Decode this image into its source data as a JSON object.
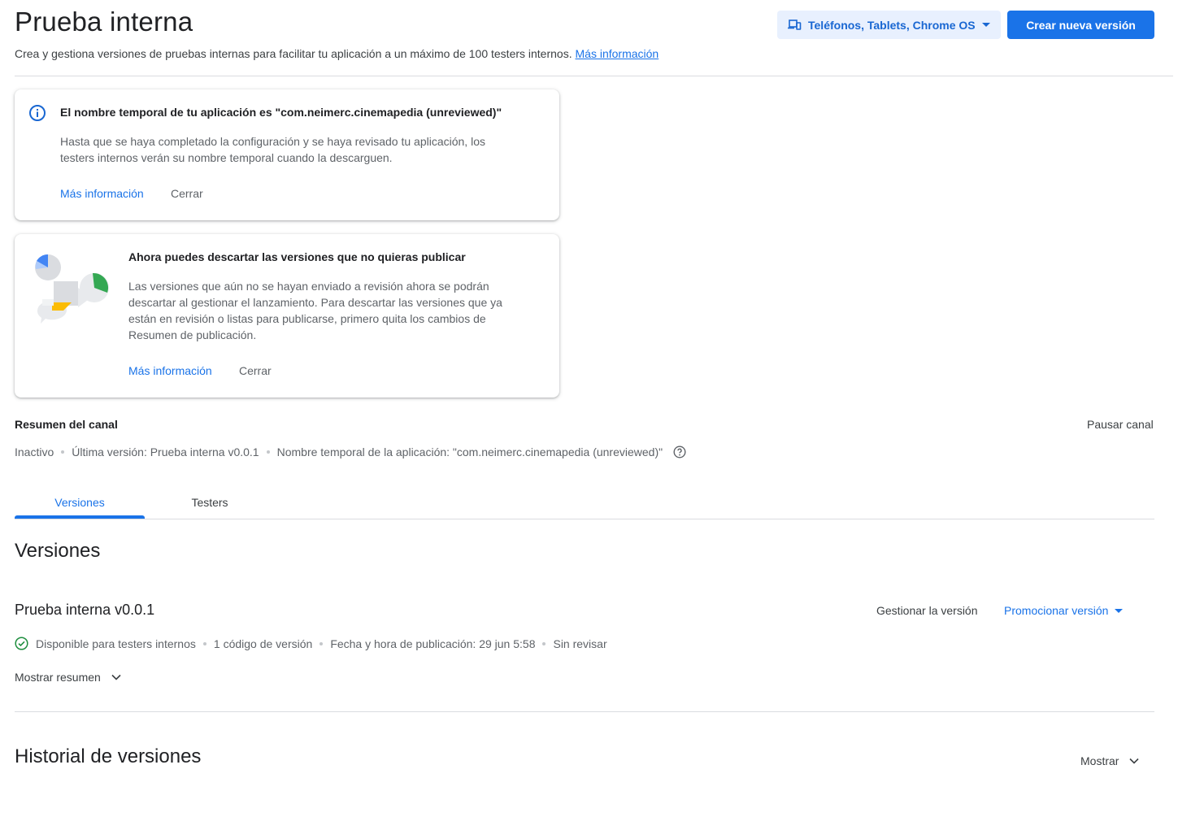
{
  "header": {
    "title": "Prueba interna",
    "subtitle": "Crea y gestiona versiones de pruebas internas para facilitar tu aplicación a un máximo de 100 testers internos.",
    "subtitle_link": "Más información",
    "device_selector": "Teléfonos, Tablets, Chrome OS",
    "create_button": "Crear nueva versión"
  },
  "notice_name": {
    "icon": "info-icon",
    "title": "El nombre temporal de tu aplicación es \"com.neimerc.cinemapedia (unreviewed)\"",
    "body": "Hasta que se haya completado la configuración y se haya revisado tu aplicación, los testers internos verán su nombre temporal cuando la descarguen.",
    "more_link": "Más información",
    "close": "Cerrar"
  },
  "notice_discard": {
    "title": "Ahora puedes descartar las versiones que no quieras publicar",
    "body": "Las versiones que aún no se hayan enviado a revisión ahora se podrán descartar al gestionar el lanzamiento. Para descartar las versiones que ya están en revisión o listas para publicarse, primero quita los cambios de Resumen de publicación.",
    "more_link": "Más información",
    "close": "Cerrar"
  },
  "channel_summary": {
    "label": "Resumen del canal",
    "pause": "Pausar canal",
    "status": "Inactivo",
    "last_version": "Última versión: Prueba interna v0.0.1",
    "temp_name": "Nombre temporal de la aplicación: \"com.neimerc.cinemapedia (unreviewed)\""
  },
  "tabs": [
    {
      "label": "Versiones",
      "active": true
    },
    {
      "label": "Testers",
      "active": false
    }
  ],
  "versions": {
    "heading": "Versiones",
    "release": {
      "name": "Prueba interna v0.0.1",
      "manage": "Gestionar la versión",
      "promote": "Promocionar versión",
      "status": "Disponible para testers internos",
      "codes": "1 código de versión",
      "published": "Fecha y hora de publicación: 29 jun 5:58",
      "review": "Sin revisar",
      "show_summary": "Mostrar resumen"
    }
  },
  "history": {
    "heading": "Historial de versiones",
    "show": "Mostrar"
  },
  "colors": {
    "accent": "#1a73e8",
    "success": "#1e8e3e",
    "divider": "#dadce0"
  }
}
